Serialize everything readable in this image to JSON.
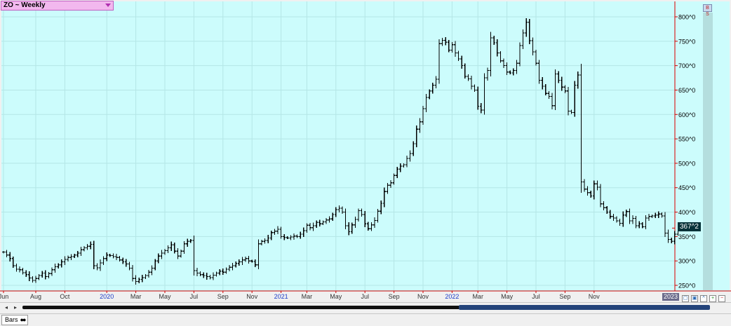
{
  "symbol_selector": {
    "label": "ZO ~ Weekly"
  },
  "last_price_label": "367^2",
  "year_flag": "2023",
  "bottom_tab": {
    "label": "Bars"
  },
  "corner_button": "B S",
  "colors": {
    "plot_background": "#ccfcfc",
    "grid": "#b4e6e6",
    "bars": "#000000",
    "axis": "#cc0000",
    "year_label": "#1c3cc8",
    "month_label": "#333333"
  },
  "chart_data": {
    "type": "ohlc",
    "timeframe": "Weekly",
    "y_axis": {
      "min": 250,
      "max": 800,
      "ticks": [
        250,
        300,
        350,
        400,
        450,
        500,
        550,
        600,
        650,
        700,
        750,
        800
      ],
      "tick_labels": [
        "250^0",
        "300^0",
        "350^0",
        "400^0",
        "450^0",
        "500^0",
        "550^0",
        "600^0",
        "650^0",
        "700^0",
        "750^0",
        "800^0"
      ]
    },
    "x_axis": {
      "labels": [
        {
          "text": "Jun",
          "bar": 0,
          "year": false
        },
        {
          "text": "Aug",
          "bar": 10,
          "year": false
        },
        {
          "text": "Oct",
          "bar": 19,
          "year": false
        },
        {
          "text": "2020",
          "bar": 32,
          "year": true
        },
        {
          "text": "Mar",
          "bar": 41,
          "year": false
        },
        {
          "text": "May",
          "bar": 50,
          "year": false
        },
        {
          "text": "Jul",
          "bar": 59,
          "year": false
        },
        {
          "text": "Sep",
          "bar": 68,
          "year": false
        },
        {
          "text": "Nov",
          "bar": 77,
          "year": false
        },
        {
          "text": "2021",
          "bar": 86,
          "year": true
        },
        {
          "text": "Mar",
          "bar": 94,
          "year": false
        },
        {
          "text": "May",
          "bar": 103,
          "year": false
        },
        {
          "text": "Jul",
          "bar": 112,
          "year": false
        },
        {
          "text": "Sep",
          "bar": 121,
          "year": false
        },
        {
          "text": "Nov",
          "bar": 130,
          "year": false
        },
        {
          "text": "2022",
          "bar": 139,
          "year": true
        },
        {
          "text": "Mar",
          "bar": 147,
          "year": false
        },
        {
          "text": "May",
          "bar": 156,
          "year": false
        },
        {
          "text": "Jul",
          "bar": 165,
          "year": false
        },
        {
          "text": "Sep",
          "bar": 174,
          "year": false
        },
        {
          "text": "Nov",
          "bar": 183,
          "year": false
        }
      ]
    },
    "last_price": 367.25,
    "closes": [
      318,
      312,
      305,
      290,
      283,
      282,
      276,
      272,
      265,
      260,
      264,
      270,
      275,
      268,
      274,
      282,
      288,
      292,
      298,
      303,
      307,
      309,
      312,
      316,
      323,
      327,
      330,
      334,
      290,
      286,
      296,
      305,
      312,
      311,
      309,
      307,
      302,
      298,
      294,
      285,
      264,
      258,
      262,
      266,
      270,
      277,
      285,
      300,
      310,
      316,
      321,
      327,
      333,
      320,
      310,
      320,
      335,
      340,
      342,
      280,
      275,
      272,
      270,
      268,
      266,
      271,
      275,
      279,
      277,
      283,
      287,
      290,
      295,
      298,
      302,
      305,
      300,
      299,
      292,
      335,
      340,
      342,
      347,
      358,
      361,
      365,
      350,
      348,
      347,
      349,
      351,
      350,
      355,
      362,
      373,
      368,
      372,
      379,
      376,
      380,
      384,
      386,
      395,
      405,
      408,
      400,
      372,
      360,
      374,
      385,
      403,
      395,
      376,
      366,
      374,
      383,
      402,
      418,
      442,
      455,
      460,
      475,
      488,
      494,
      497,
      510,
      520,
      540,
      570,
      585,
      612,
      635,
      648,
      660,
      672,
      745,
      752,
      748,
      732,
      743,
      726,
      714,
      700,
      678,
      673,
      658,
      650,
      617,
      609,
      675,
      690,
      757,
      747,
      726,
      710,
      700,
      687,
      685,
      690,
      705,
      741,
      767,
      789,
      751,
      728,
      705,
      670,
      658,
      643,
      637,
      618,
      683,
      670,
      656,
      648,
      607,
      604,
      660,
      681,
      462,
      447,
      440,
      433,
      458,
      451,
      417,
      409,
      400,
      391,
      388,
      382,
      377,
      394,
      401,
      382,
      387,
      372,
      376,
      370,
      388,
      391,
      392,
      394,
      396,
      392,
      357,
      344,
      340,
      355,
      365,
      367
    ]
  }
}
